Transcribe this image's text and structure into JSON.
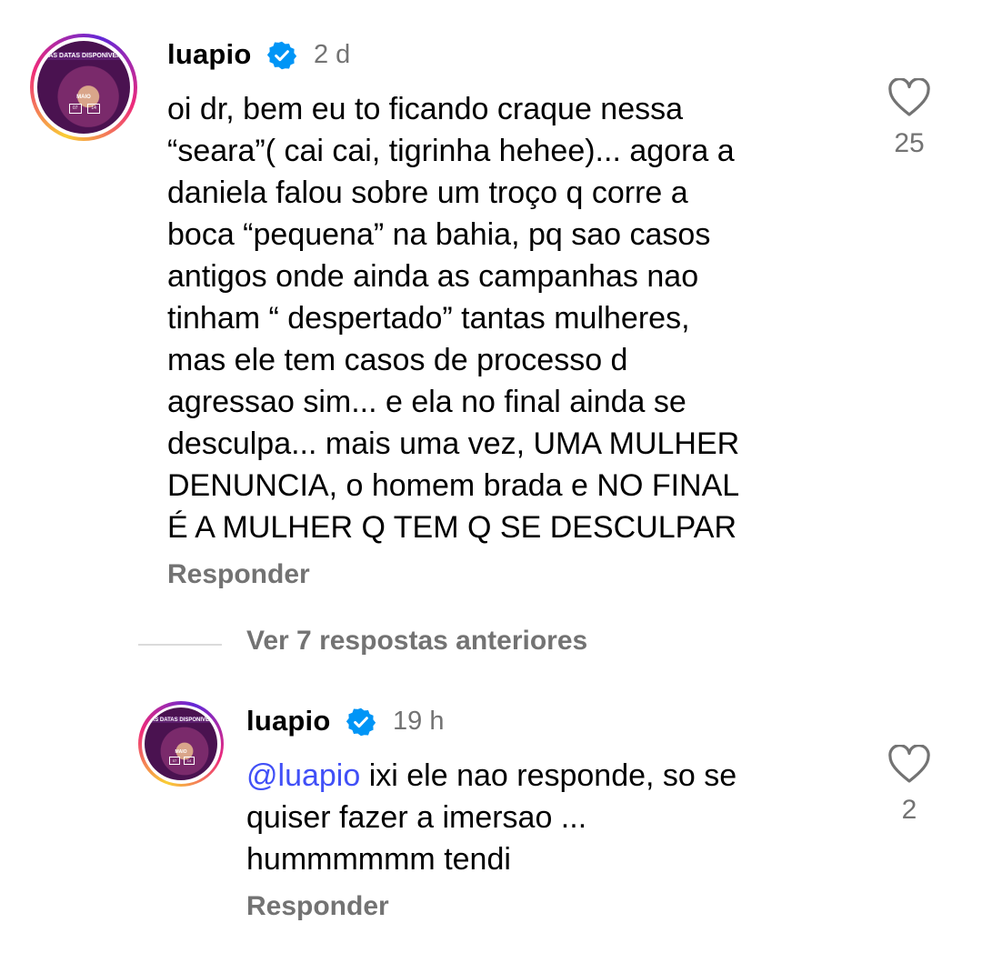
{
  "comments": [
    {
      "username": "luapio",
      "time": "2 d",
      "text": "oi dr, bem eu to ficando craque nessa\n“seara”( cai cai, tigrinha hehee)... agora a\ndaniela falou sobre um troço q corre a\nboca “pequena” na bahia, pq sao casos\nantigos onde ainda as campanhas nao\ntinham “ despertado” tantas mulheres,\nmas ele tem casos de processo d\nagressao sim... e ela no final ainda se\ndesculpa... mais uma vez, UMA MULHER\nDENUNCIA, o homem brada e NO FINAL\nÉ A MULHER Q TEM Q SE DESCULPAR",
      "reply_label": "Responder",
      "likes": "25",
      "avatar": {
        "banner": "VAS DATAS DISPONÍVEIS",
        "month": "MAIO",
        "day1": "07",
        "day2": "14"
      }
    },
    {
      "username": "luapio",
      "time": "19 h",
      "mention": "@luapio",
      "text": " ixi ele nao responde, so se\nquiser fazer a imersao ...\nhummmmmm tendi",
      "reply_label": "Responder",
      "likes": "2",
      "avatar": {
        "banner": "VAS DATAS DISPONÍVEIS",
        "month": "MAIO",
        "day1": "07",
        "day2": "14"
      }
    }
  ],
  "view_replies": "Ver 7 respostas anteriores",
  "icons": {
    "verified": "verified-badge-icon",
    "like": "heart-outline-icon"
  },
  "colors": {
    "verified_blue": "#0095f6",
    "secondary_text": "#737373",
    "mention": "#4150f7"
  }
}
